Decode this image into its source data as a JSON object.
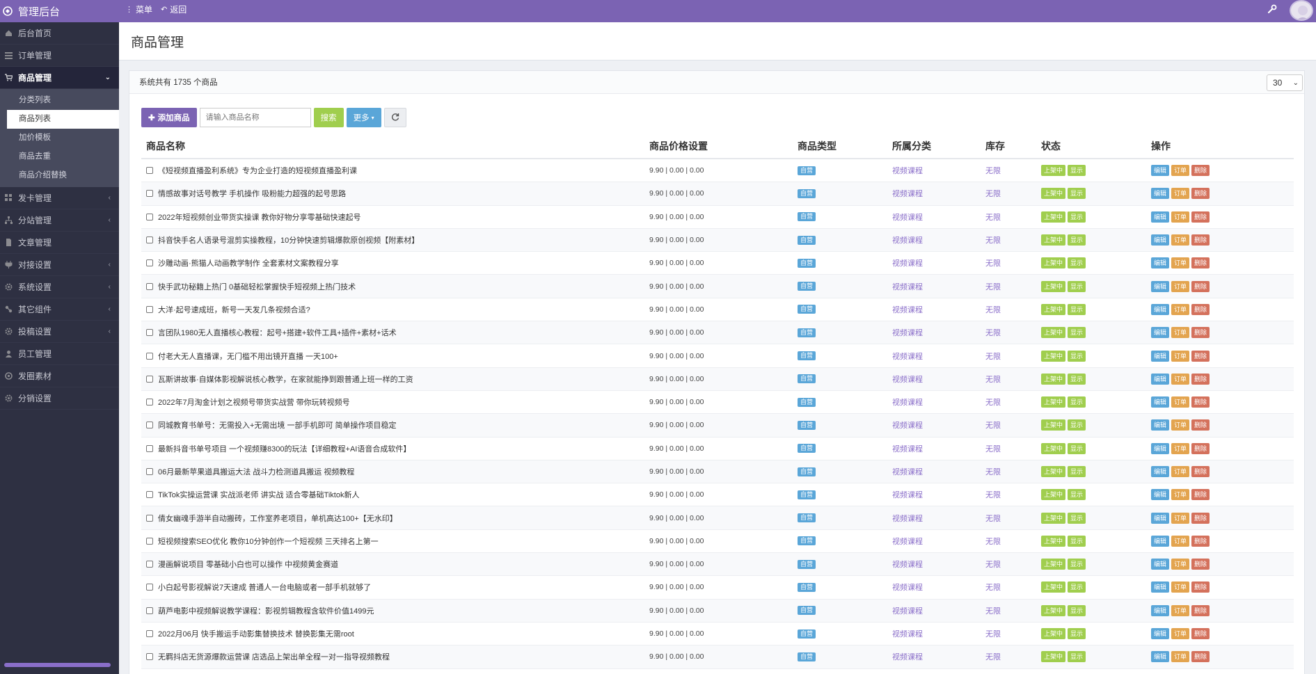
{
  "app": {
    "title": "管理后台"
  },
  "topnav": {
    "menu": "菜单",
    "back": "返回"
  },
  "sidebar": {
    "items": [
      {
        "label": "后台首页",
        "icon": "home-icon"
      },
      {
        "label": "订单管理",
        "icon": "list-icon"
      },
      {
        "label": "商品管理",
        "icon": "cart-icon",
        "active": true
      },
      {
        "label": "发卡管理",
        "icon": "grid-icon"
      },
      {
        "label": "分站管理",
        "icon": "sitemap-icon"
      },
      {
        "label": "文章管理",
        "icon": "file-icon"
      },
      {
        "label": "对接设置",
        "icon": "plug-icon"
      },
      {
        "label": "系统设置",
        "icon": "gear-icon"
      },
      {
        "label": "其它组件",
        "icon": "puzzle-icon"
      },
      {
        "label": "投稿设置",
        "icon": "gear-icon"
      },
      {
        "label": "员工管理",
        "icon": "user-icon"
      },
      {
        "label": "发圈素材",
        "icon": "circle-icon"
      },
      {
        "label": "分销设置",
        "icon": "gear-icon"
      }
    ],
    "submenu": [
      "分类列表",
      "商品列表",
      "加价模板",
      "商品去重",
      "商品介绍替换"
    ]
  },
  "page": {
    "title": "商品管理",
    "summary": "系统共有 1735 个商品",
    "page_size": "30"
  },
  "toolbar": {
    "add": "添加商品",
    "search_placeholder": "请输入商品名称",
    "search": "搜索",
    "more": "更多"
  },
  "table": {
    "headers": [
      "商品名称",
      "商品价格设置",
      "商品类型",
      "所属分类",
      "库存",
      "状态",
      "操作"
    ],
    "price": "9.90 | 0.00 | 0.00",
    "type_badge": "自营",
    "category": "视频课程",
    "stock": "无限",
    "status_on": "上架中",
    "status_show": "显示",
    "op_edit": "编辑",
    "op_order": "订单",
    "op_delete": "删除",
    "rows": [
      "《短视频直播盈利系统》专为企业打造的短视频直播盈利课",
      "情感故事对话号教学 手机操作 吸粉能力超强的起号思路",
      "2022年短视频创业带货实操课 教你好物分享零基础快速起号",
      "抖音快手名人语录号混剪实操教程，10分钟快速剪辑爆款原创视频【附素材】",
      "沙雕动画·熊猫人动画教学制作 全套素材文案教程分享",
      "快手武功秘籍上热门 0基础轻松掌握快手短视频上热门技术",
      "大洋·起号速成班，新号一天发几条视频合适?",
      "言团队1980无人直播核心教程：起号+搭建+软件工具+插件+素材+话术",
      "付老大无人直播课，无门槛不用出镜开直播 一天100+",
      "瓦斯讲故事·自媒体影视解说核心教学，在家就能挣到跟普通上班一样的工资",
      "2022年7月淘金计划之视频号带货实战营 带你玩转视频号",
      "同城教育书单号：无需投入+无需出境 一部手机即可 简单操作项目稳定",
      "最新抖音书单号项目 一个视频赚8300的玩法【详细教程+AI语音合成软件】",
      "06月最新苹果道具搬运大法 战斗力检测道具搬运 视频教程",
      "TikTok实操运营课 实战派老师 讲实战 适合零基础Tiktok新人",
      "倩女幽魂手游半自动搬砖，工作室养老项目，单机高达100+【无水印】",
      "短视频搜索SEO优化 教你10分钟创作一个短视频 三天排名上第一",
      "漫画解说项目 零基础小白也可以操作 中视频黄金赛道",
      "小白起号影视解说7天速成 普通人一台电脑或者一部手机就够了",
      "葫芦电影中视频解说教学课程：影视剪辑教程含软件价值1499元",
      "2022月06月 快手搬运手动影集替换技术 替换影集无需root",
      "无羁抖店无货源爆款运营课 店选品上架出单全程一对一指导视频教程"
    ]
  },
  "colors": {
    "accent": "#7b63b3",
    "sidebar": "#2e3042",
    "green": "#a0ce4e",
    "blue": "#5aa6d8",
    "orange": "#e3a44f",
    "red": "#d4715c"
  }
}
